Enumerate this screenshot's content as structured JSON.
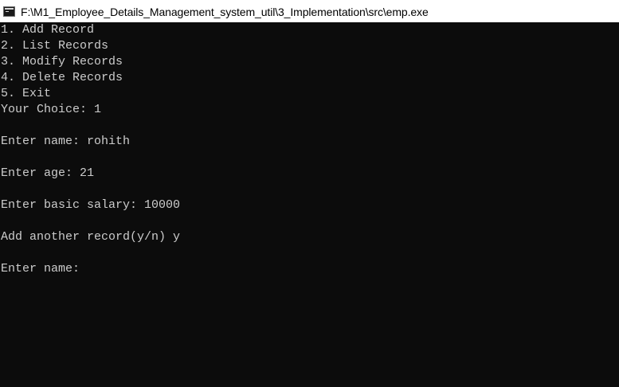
{
  "window": {
    "title": "F:\\M1_Employee_Details_Management_system_util\\3_Implementation\\src\\emp.exe",
    "icon": "console-app-icon"
  },
  "console": {
    "text_color": "#cccccc",
    "background_color": "#0c0c0c",
    "lines": [
      "1. Add Record",
      "2. List Records",
      "3. Modify Records",
      "4. Delete Records",
      "5. Exit",
      "Your Choice: 1",
      "",
      "Enter name: rohith",
      "",
      "Enter age: 21",
      "",
      "Enter basic salary: 10000",
      "",
      "Add another record(y/n) y",
      "",
      "Enter name: "
    ]
  }
}
